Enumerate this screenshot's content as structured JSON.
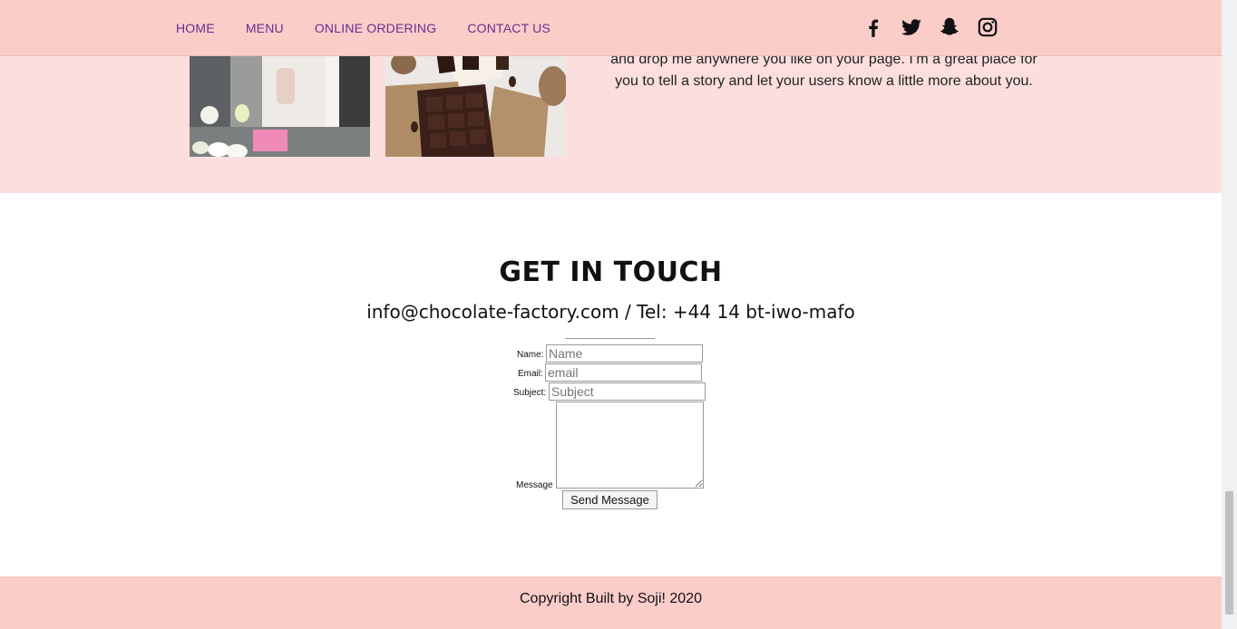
{
  "nav": {
    "items": [
      "HOME",
      "MENU",
      "ONLINE ORDERING",
      "CONTACT US"
    ]
  },
  "social": {
    "icons": [
      "facebook-icon",
      "twitter-icon",
      "snapchat-icon",
      "instagram-icon"
    ]
  },
  "about": {
    "text_line1": "and drop me anywhere you like on your page. I’m a great place for",
    "text_line2": "you to tell a story and let your users know a little more about you."
  },
  "contact": {
    "title": "GET IN TOUCH",
    "info": "info@chocolate-factory.com / Tel: +44 14 bt-iwo-mafo",
    "form": {
      "name_label": "Name:",
      "name_placeholder": "Name",
      "email_label": "Email:",
      "email_placeholder": "email",
      "subject_label": "Subject:",
      "subject_placeholder": "Subject",
      "message_label": "Message",
      "send_label": "Send Message"
    }
  },
  "footer": {
    "copyright": "Copyright Built by Soji! 2020"
  },
  "colors": {
    "header_bg": "#fbcdc9",
    "section_bg": "#fddede",
    "nav_link": "#6a2c8f"
  }
}
